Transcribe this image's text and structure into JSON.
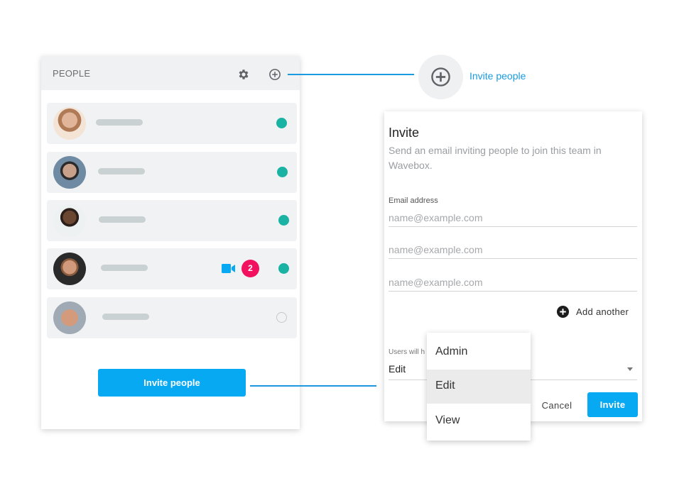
{
  "people_panel": {
    "title": "PEOPLE",
    "header_icons": [
      "gear-icon",
      "add-circle-icon"
    ],
    "members": [
      {
        "avatar": "woman-with-short-hair",
        "status": "online",
        "video_call": false,
        "unread": null
      },
      {
        "avatar": "man-dark-hair",
        "status": "online",
        "video_call": false,
        "unread": null
      },
      {
        "avatar": "woman-smiling",
        "status": "online",
        "video_call": false,
        "unread": null
      },
      {
        "avatar": "man-with-beard",
        "status": "online",
        "video_call": true,
        "unread": "2"
      },
      {
        "avatar": "man-smiling-round-face",
        "status": "offline",
        "video_call": false,
        "unread": null
      }
    ],
    "invite_button_label": "Invite people"
  },
  "callout": {
    "icon": "add-circle-icon",
    "label": "Invite people"
  },
  "invite_dialog": {
    "title": "Invite",
    "subtitle": "Send an email inviting people to join this team in Wavebox.",
    "email_label": "Email address",
    "email_fields": [
      {
        "value": "",
        "placeholder": "name@example.com"
      },
      {
        "value": "",
        "placeholder": "name@example.com"
      },
      {
        "value": "",
        "placeholder": "name@example.com"
      }
    ],
    "add_another_label": "Add another",
    "role_label": "Users will h",
    "role_value": "Edit",
    "cancel_label": "Cancel",
    "invite_label": "Invite"
  },
  "role_menu": {
    "options": [
      "Admin",
      "Edit",
      "View"
    ],
    "selected": "Edit"
  },
  "colors": {
    "accent": "#07a9f2",
    "online": "#1ab3a3",
    "badge": "#f2115e",
    "connector": "#1a9be0"
  }
}
